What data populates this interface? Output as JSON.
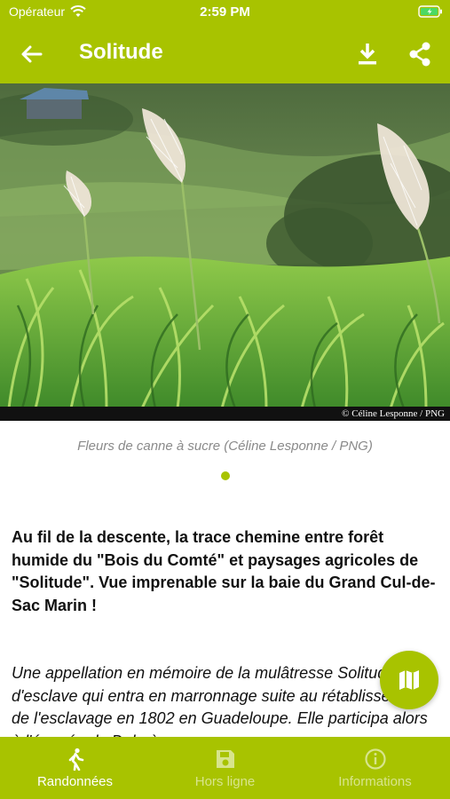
{
  "status_bar": {
    "carrier": "Opérateur",
    "time": "2:59 PM"
  },
  "app_bar": {
    "title": "Solitude"
  },
  "hero": {
    "credit": "© Céline Lesponne / PNG"
  },
  "caption": "Fleurs de canne à sucre (Céline Lesponne / PNG)",
  "carousel": {
    "current_page": 1,
    "page_count": 1
  },
  "content": {
    "lead": "Au fil de la descente, la trace chemine entre forêt humide du \"Bois du Comté\" et paysages agricoles de \"Solitude\". Vue imprenable sur la baie du Grand Cul-de-Sac Marin !",
    "body": "Une appellation en mémoire de la mulâtresse Solitude, fille d'esclave qui entra en marronnage suite au rétablissement de l'esclavage en 1802 en Guadeloupe. Elle participa alors à l'épopée de Delgrès"
  },
  "bottom_nav": {
    "items": [
      {
        "label": "Randonnées",
        "icon": "hiker-icon",
        "active": true
      },
      {
        "label": "Hors ligne",
        "icon": "save-icon",
        "active": false
      },
      {
        "label": "Informations",
        "icon": "info-icon",
        "active": false
      }
    ]
  },
  "colors": {
    "accent": "#a8c300",
    "caption": "#8a8a8a"
  }
}
